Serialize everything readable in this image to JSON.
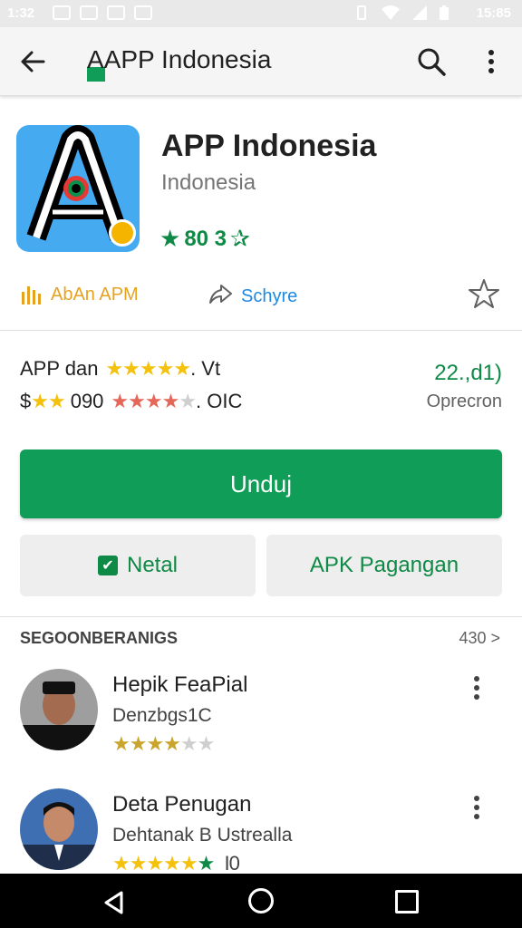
{
  "status_bar": {
    "time_left": "1:32",
    "time_right": "15:85"
  },
  "toolbar": {
    "title": "AAPP Indonesia"
  },
  "app": {
    "name": "APP Indonesia",
    "developer": "Indonesia",
    "rating_text": "80 3"
  },
  "actions": {
    "ads_label": "AbAn APM",
    "share_label": "Schyre"
  },
  "ratings": {
    "line1_label": "APP dan",
    "line1_suffix": ". Vt",
    "line2_prefix": "$",
    "line2_value": "090",
    "line2_suffix": ". OIC",
    "count": "22.,d1)",
    "count_label": "Oprecron"
  },
  "buttons": {
    "install": "Unduj",
    "install_secondary": "Netal",
    "apk": "APK Pagangan"
  },
  "reviews_section": {
    "heading": "SEGOONBERANIGS",
    "more": "430 >"
  },
  "reviews": [
    {
      "name": "Hepik FeaPial",
      "subtitle": "Denzbgs1C",
      "stars_filled": 4,
      "stars_total": 6
    },
    {
      "name": "Deta Penugan",
      "subtitle": "Dehtanak B Ustrealla",
      "stars_filled": 6,
      "stars_total": 6,
      "stars_suffix": "I0"
    }
  ],
  "colors": {
    "primary_green": "#0f9d58",
    "rating_green": "#0f8a46",
    "icon_blue": "#46aaf0",
    "ads_orange": "#e6a321",
    "share_blue": "#1e88e5"
  }
}
